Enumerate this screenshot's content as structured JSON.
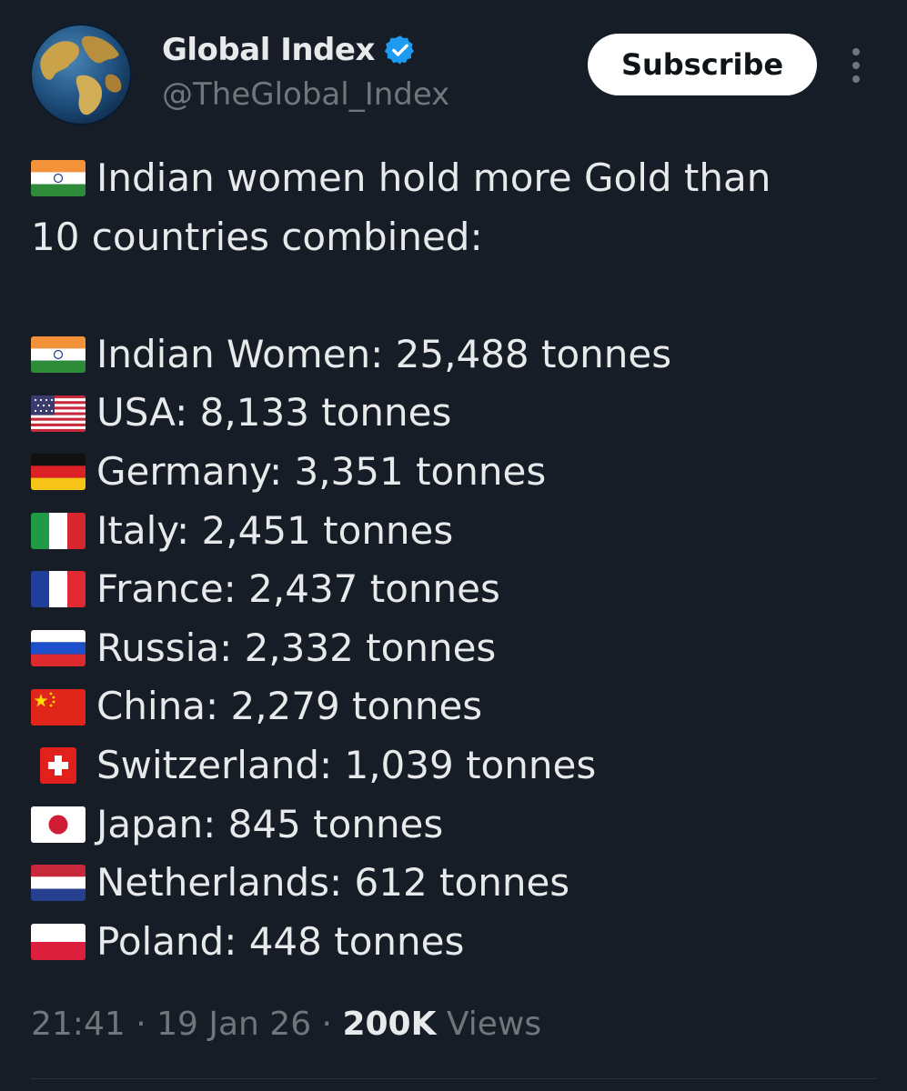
{
  "author": {
    "display_name": "Global Index",
    "handle": "@TheGlobal_Index",
    "verified": true,
    "avatar_icon": "globe-avatar"
  },
  "actions": {
    "subscribe_label": "Subscribe",
    "more_icon": "more-vertical-icon"
  },
  "tweet": {
    "intro_flag": "india-flag",
    "intro_line1": "Indian women hold more Gold than",
    "intro_line2": "10 countries combined:",
    "items": [
      {
        "flag": "india-flag",
        "text": "Indian Women: 25,488 tonnes"
      },
      {
        "flag": "usa-flag",
        "text": "USA: 8,133 tonnes"
      },
      {
        "flag": "germany-flag",
        "text": "Germany: 3,351 tonnes"
      },
      {
        "flag": "italy-flag",
        "text": "Italy: 2,451 tonnes"
      },
      {
        "flag": "france-flag",
        "text": "France: 2,437 tonnes"
      },
      {
        "flag": "russia-flag",
        "text": "Russia: 2,332 tonnes"
      },
      {
        "flag": "china-flag",
        "text": "China: 2,279 tonnes"
      },
      {
        "flag": "switzerland-flag",
        "text": "Switzerland: 1,039 tonnes"
      },
      {
        "flag": "japan-flag",
        "text": "Japan: 845 tonnes"
      },
      {
        "flag": "netherlands-flag",
        "text": "Netherlands: 612 tonnes"
      },
      {
        "flag": "poland-flag",
        "text": "Poland: 448 tonnes"
      }
    ]
  },
  "meta": {
    "time": "21:41",
    "sep1": " · ",
    "date": "19 Jan 26",
    "sep2": " · ",
    "views_count": "200K",
    "views_label": " Views"
  },
  "colors": {
    "background": "#161d26",
    "text": "#e7e9ea",
    "muted": "#71767b",
    "verified_blue": "#1d9bf0",
    "button_bg": "#ffffff"
  }
}
